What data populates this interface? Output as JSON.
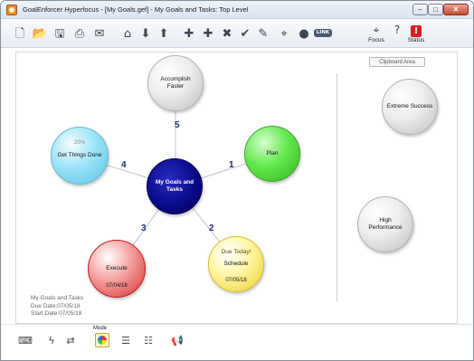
{
  "window": {
    "title": "GoalEnforcer Hyperfocus  -  [My Goals.gef]  -  My Goals and Tasks: Top Level",
    "minimize_label": "–",
    "maximize_label": "□",
    "close_label": "✕"
  },
  "toolbar": {
    "buttons": [
      {
        "name": "new-icon",
        "glyph": "🗋"
      },
      {
        "name": "open-icon",
        "glyph": "📂"
      },
      {
        "name": "save-icon",
        "glyph": "🖫"
      },
      {
        "name": "print-icon",
        "glyph": "⎙"
      },
      {
        "name": "email-icon",
        "glyph": "✉"
      },
      {
        "name": "home-icon",
        "glyph": "⌂"
      },
      {
        "name": "arrow-down-icon",
        "glyph": "⬇"
      },
      {
        "name": "arrow-up-icon",
        "glyph": "⬆"
      },
      {
        "name": "add-icon",
        "glyph": "✚"
      },
      {
        "name": "add-subgoal-icon",
        "glyph": "✚"
      },
      {
        "name": "delete-icon",
        "glyph": "✖"
      },
      {
        "name": "complete-checkmark-icon",
        "glyph": "✔"
      },
      {
        "name": "edit-notes-icon",
        "glyph": "✎"
      },
      {
        "name": "target-icon",
        "glyph": "⌖"
      },
      {
        "name": "clipboard-icon",
        "glyph": "●"
      }
    ],
    "link_label": "LINK",
    "focus": {
      "icon": "⌖",
      "label": "Focus"
    },
    "help": {
      "icon": "?",
      "label": ""
    },
    "status": {
      "icon": "!",
      "label": "Status"
    }
  },
  "canvas": {
    "clipboard_label": "Clipboard Area",
    "center": {
      "label": "My Goals and Tasks"
    },
    "goals": [
      {
        "label": "Accomplish Faster",
        "number": "5",
        "color": "gray"
      },
      {
        "label": "Plan",
        "number": "1",
        "color": "green"
      },
      {
        "label": "Schedule",
        "number": "2",
        "color": "yellow",
        "due": "Due Today!",
        "date": "07/05/18"
      },
      {
        "label": "Execute",
        "number": "3",
        "color": "red",
        "date": "07/04/18"
      },
      {
        "label": "Get Things Done",
        "number": "4",
        "color": "blue",
        "percent": "20%"
      }
    ],
    "clipboard_items": [
      {
        "label": "Extreme Success"
      },
      {
        "label": "High Performance"
      }
    ]
  },
  "info": {
    "title": "My Goals and Tasks",
    "due": "Due  Date:07/05/18",
    "start": "Start Date:07/05/18"
  },
  "bottombar": {
    "mode_label": "Mode",
    "buttons": [
      {
        "name": "keyboard-icon",
        "glyph": "⌨"
      },
      {
        "name": "lightning-icon",
        "glyph": "ϟ"
      },
      {
        "name": "swap-icon",
        "glyph": "⇄"
      },
      {
        "name": "bubble-mode-icon",
        "glyph": ""
      },
      {
        "name": "list-mode-icon",
        "glyph": "☰"
      },
      {
        "name": "gantt-mode-icon",
        "glyph": "☷"
      },
      {
        "name": "announce-icon",
        "glyph": "📢"
      }
    ]
  },
  "colors": {
    "center": "#0a0a8a",
    "green": "#63e84e",
    "yellow": "#fff5a2",
    "red": "#d62f2f",
    "blue": "#9be4f7",
    "gray": "#ececec",
    "edge_number": "#1f2d6e"
  }
}
